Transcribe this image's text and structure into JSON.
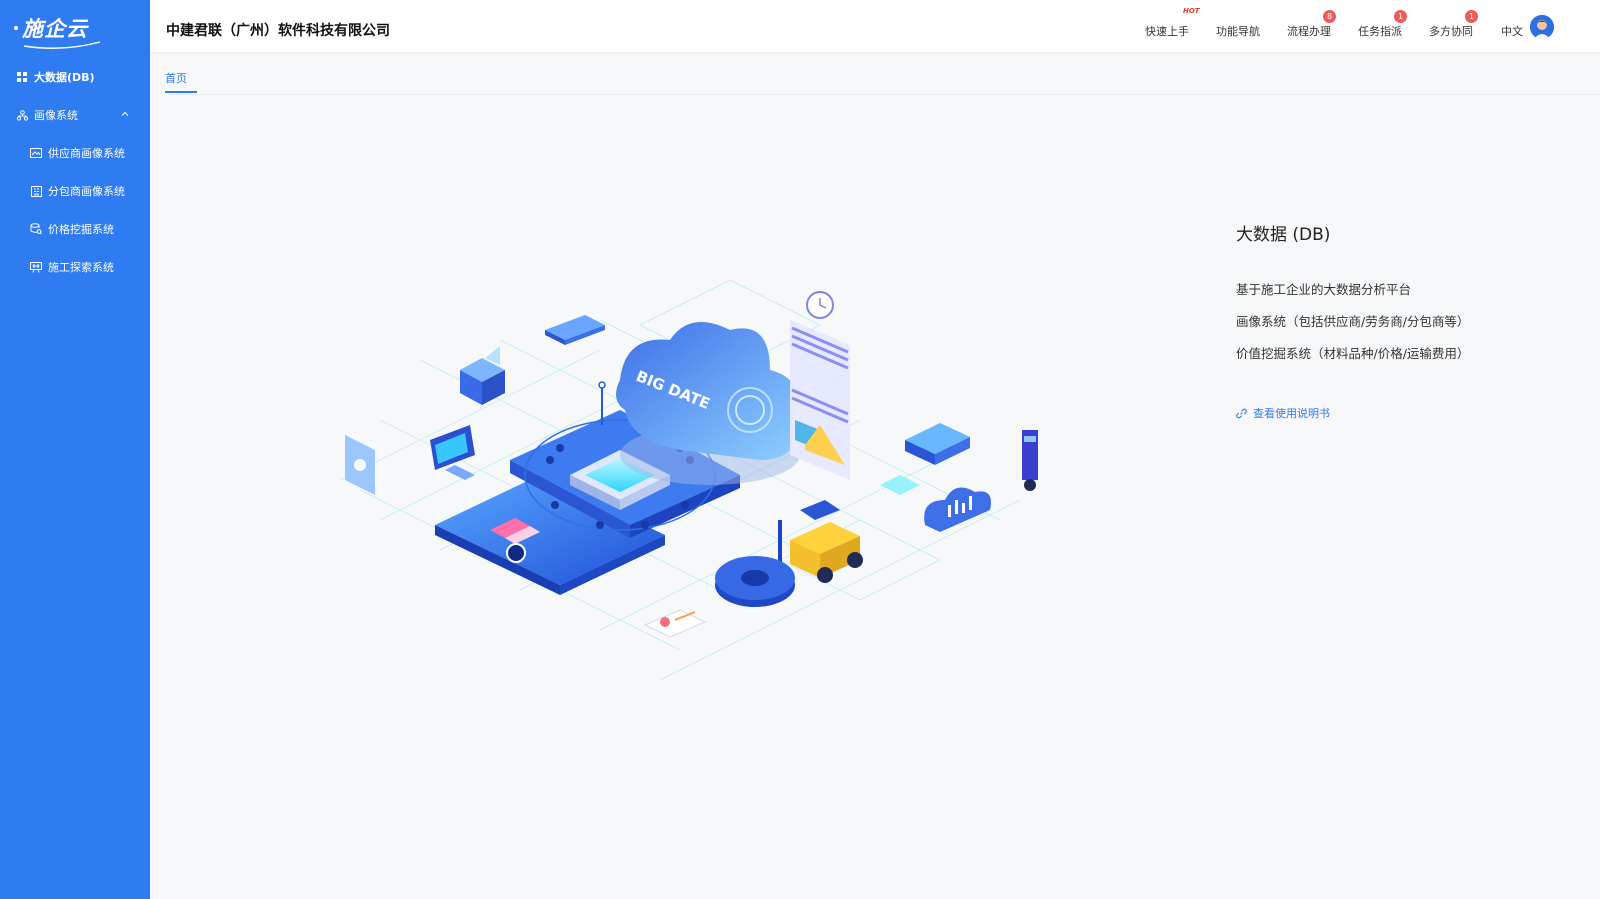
{
  "sidebar": {
    "logo_text": "施企云",
    "items": [
      {
        "label": "大数据(DB)",
        "icon": "grid-icon"
      },
      {
        "label": "画像系统",
        "icon": "org-chart-icon",
        "expanded": true
      },
      {
        "label": "供应商画像系统",
        "icon": "image-card-icon"
      },
      {
        "label": "分包商画像系统",
        "icon": "building-icon"
      },
      {
        "label": "价格挖掘系统",
        "icon": "database-search-icon"
      },
      {
        "label": "施工探索系统",
        "icon": "construction-icon"
      }
    ]
  },
  "header": {
    "company": "中建君联（广州）软件科技有限公司",
    "nav": [
      {
        "label": "快速上手",
        "hot": "HOT"
      },
      {
        "label": "功能导航"
      },
      {
        "label": "流程办理",
        "badge": "8"
      },
      {
        "label": "任务指派",
        "badge": "1"
      },
      {
        "label": "多方协同",
        "badge": "1"
      }
    ],
    "language": "中文"
  },
  "tabs": [
    {
      "label": "首页",
      "active": true
    }
  ],
  "illustration": {
    "cloud_text": "BIG DATE"
  },
  "info": {
    "title": "大数据 (DB)",
    "lines": [
      "基于施工企业的大数据分析平台",
      "画像系统（包括供应商/劳务商/分包商等）",
      "价值挖掘系统（材料品种/价格/运输费用）"
    ],
    "manual_link": "查看使用说明书"
  },
  "colors": {
    "sidebar": "#2f7bf2",
    "accent": "#2f7bf2",
    "badge": "#ef5a5a",
    "hot": "#e53a2a"
  }
}
